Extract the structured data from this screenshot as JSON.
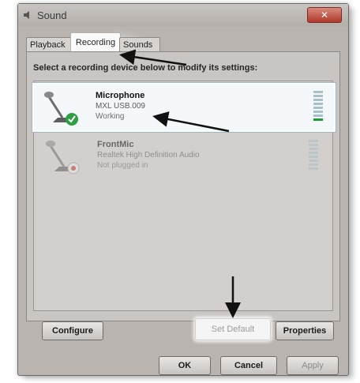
{
  "window": {
    "title": "Sound",
    "close_label": "✕"
  },
  "tabs": [
    {
      "label": "Playback"
    },
    {
      "label": "Recording"
    },
    {
      "label": "Sounds"
    }
  ],
  "instruction": "Select a recording device below to modify its settings:",
  "devices": [
    {
      "name": "Microphone",
      "sub": "MXL USB.009",
      "status": "Working",
      "status_icon": "green-check-icon"
    },
    {
      "name": "FrontMic",
      "sub": "Realtek High Definition Audio",
      "status": "Not plugged in",
      "status_icon": "red-unplugged-icon"
    }
  ],
  "buttons": {
    "configure": "Configure",
    "set_default": "Set Default",
    "properties": "Properties",
    "ok": "OK",
    "cancel": "Cancel",
    "apply": "Apply"
  },
  "colors": {
    "accent_green": "#1d9b3a",
    "close_red": "#b1392a"
  }
}
